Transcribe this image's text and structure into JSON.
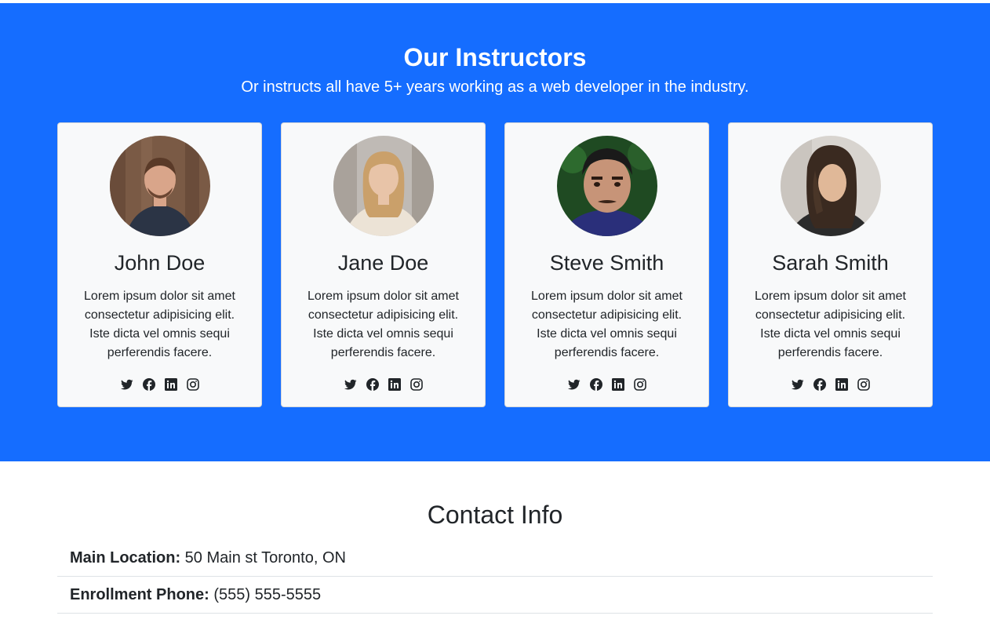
{
  "instructors": {
    "heading": "Our Instructors",
    "subheading": "Or instructs all have 5+ years working as a web developer in the industry.",
    "cards": [
      {
        "name": "John Doe",
        "bio": "Lorem ipsum dolor sit amet consectetur adipisicing elit. Iste dicta vel omnis sequi perferendis facere.",
        "colors": {
          "bg": "#7a5a45",
          "skin": "#d9a58a",
          "hair": "#5a3a28",
          "shirt": "#2b3445"
        }
      },
      {
        "name": "Jane Doe",
        "bio": "Lorem ipsum dolor sit amet consectetur adipisicing elit. Iste dicta vel omnis sequi perferendis facere.",
        "colors": {
          "bg": "#bfbab5",
          "skin": "#e8c4a8",
          "hair": "#caa06a",
          "shirt": "#ece3d6"
        }
      },
      {
        "name": "Steve Smith",
        "bio": "Lorem ipsum dolor sit amet consectetur adipisicing elit. Iste dicta vel omnis sequi perferendis facere.",
        "colors": {
          "bg": "#1f4a22",
          "skin": "#c79478",
          "hair": "#1a1a1a",
          "shirt": "#2a2f7a"
        }
      },
      {
        "name": "Sarah Smith",
        "bio": "Lorem ipsum dolor sit amet consectetur adipisicing elit. Iste dicta vel omnis sequi perferendis facere.",
        "colors": {
          "bg": "#d8d4cf",
          "skin": "#e0b898",
          "hair": "#3a2a20",
          "shirt": "#2b2b2b"
        }
      }
    ],
    "social_icons": [
      "twitter-icon",
      "facebook-icon",
      "linkedin-icon",
      "instagram-icon"
    ],
    "accent": "#156dff"
  },
  "contact": {
    "heading": "Contact Info",
    "items": [
      {
        "label": "Main Location:",
        "value": "50 Main st Toronto, ON"
      },
      {
        "label": "Enrollment Phone:",
        "value": "(555) 555-5555"
      }
    ]
  }
}
